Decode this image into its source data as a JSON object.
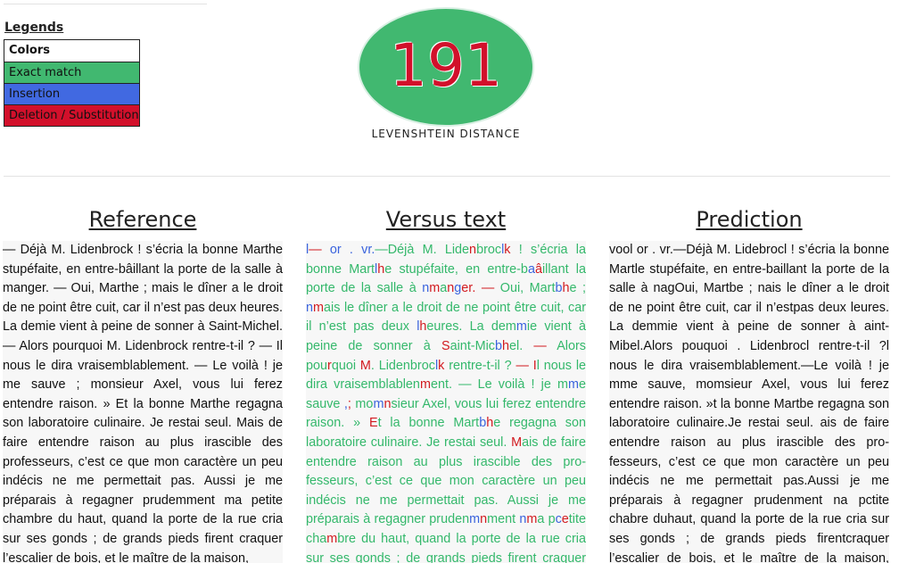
{
  "legend": {
    "title": "Legends",
    "header": "Colors",
    "items": [
      {
        "label": "Exact match",
        "color": "#41b870"
      },
      {
        "label": "Insertion",
        "color": "#4169e1"
      },
      {
        "label": "Deletion / Substitution",
        "color": "#d2102b"
      }
    ]
  },
  "score": {
    "value": "191",
    "label": "LEVENSHTEIN DISTANCE",
    "ellipse_color": "#41b870",
    "number_color": "#d2102b"
  },
  "columns": {
    "reference_title": "Reference",
    "versus_title": "Versus text",
    "prediction_title": "Prediction"
  },
  "reference_text": "— Déjà M. Lidenbrock ! s’écria la bonne Marthe stupéfaite, en entre-bâillant la porte de la salle à manger. — Oui, Marthe ; mais le dîner a le droit de ne point être cuit, car il n’est pas deux heures. La demie vient à peine de sonner à Saint-Michel. — Alors pourquoi M. Lidenbrock rentre-t-il ? — Il nous le dira vraisemblablement. — Le voilà ! je me sauve ; monsieur Axel, vous lui ferez entendre raison. » Et la bonne Marthe regagna son laboratoire culinaire. Je restai seul. Mais de faire entendre raison au plus irascible des professeurs, c’est ce que mon caractère un peu indécis ne me permettait pas. Aussi je me préparais à regagner prudemment ma petite chambre du haut, quand la porte de la rue cria sur ses gonds ; de grands pieds firent craquer l’escalier de bois, et le maître de la maison,",
  "prediction_text": "vool or . vr.—Déjà M. Lidebrocl ! s’écria la bonne Martle stupéfaite, en entre-baillant la porte de la salle à nagOui, Martbe ; nais le dîner a le droit de ne point être cuit, car il n’estpas deux leures. La demmie vient à peine de sonner à aint-Mibel.Alors pouquoi . Lidenbrocl rentre-t-il ?l nous le dira vraisemblablement.—Le voilà ! je mme sauve, momsieur Axel, vous lui ferez entendre raison. »t la bonne Martbe regagna son laboratoire culinaire.Je restai seul. ais de faire entendre raison au plus irascible des pro-fesseurs, c’est ce que mon caractère un peu indécis ne me permettait pas.Aussi je me préparais à regagner prudenment na pctite chabre duhaut, quand la porte de la rue cria sur ses gonds ; de grands pieds firentcraquer l’escalier de bois, et le maître de la maison, traversant la",
  "versus_segments": [
    {
      "t": "l",
      "k": "ins"
    },
    {
      "t": "— ",
      "k": "del"
    },
    {
      "t": "or . vr.",
      "k": "ins"
    },
    {
      "t": "—Déjà M. Lide",
      "k": "match"
    },
    {
      "t": "n",
      "k": "del"
    },
    {
      "t": "broc",
      "k": "match"
    },
    {
      "t": "l",
      "k": "ins"
    },
    {
      "t": "k",
      "k": "del"
    },
    {
      "t": " ! s’écria la bonne Mart",
      "k": "match"
    },
    {
      "t": "l",
      "k": "ins"
    },
    {
      "t": "h",
      "k": "del"
    },
    {
      "t": "e stupéfaite, en entre-b",
      "k": "match"
    },
    {
      "t": "a",
      "k": "ins"
    },
    {
      "t": "â",
      "k": "del"
    },
    {
      "t": "illant la porte de la salle à ",
      "k": "match"
    },
    {
      "t": "n",
      "k": "ins"
    },
    {
      "t": "m",
      "k": "del"
    },
    {
      "t": "a",
      "k": "match"
    },
    {
      "t": "n",
      "k": "del"
    },
    {
      "t": "g",
      "k": "ins"
    },
    {
      "t": "er",
      "k": "del"
    },
    {
      "t": ". — ",
      "k": "del"
    },
    {
      "t": "Oui, Mart",
      "k": "match"
    },
    {
      "t": "b",
      "k": "ins"
    },
    {
      "t": "h",
      "k": "del"
    },
    {
      "t": "e ; ",
      "k": "match"
    },
    {
      "t": "n",
      "k": "ins"
    },
    {
      "t": "m",
      "k": "del"
    },
    {
      "t": "ais le dîner a le droit de ne point être cuit, car il n’est pas deux ",
      "k": "match"
    },
    {
      "t": "l",
      "k": "ins"
    },
    {
      "t": "h",
      "k": "del"
    },
    {
      "t": "eures. La dem",
      "k": "match"
    },
    {
      "t": "m",
      "k": "ins"
    },
    {
      "t": "ie vient à peine de sonner à ",
      "k": "match"
    },
    {
      "t": "S",
      "k": "del"
    },
    {
      "t": "aint-Mic",
      "k": "match"
    },
    {
      "t": "b",
      "k": "ins"
    },
    {
      "t": "h",
      "k": "del"
    },
    {
      "t": "el. ",
      "k": "match"
    },
    {
      "t": "— ",
      "k": "del"
    },
    {
      "t": "Alors pou",
      "k": "match"
    },
    {
      "t": "r",
      "k": "del"
    },
    {
      "t": "quoi ",
      "k": "match"
    },
    {
      "t": "M",
      "k": "del"
    },
    {
      "t": ". Lidenbroc",
      "k": "match"
    },
    {
      "t": "l",
      "k": "ins"
    },
    {
      "t": "k",
      "k": "del"
    },
    {
      "t": " rentre-t-il ? ",
      "k": "match"
    },
    {
      "t": "— I",
      "k": "del"
    },
    {
      "t": "l",
      "k": "match"
    },
    {
      "t": " nous le dira vraisemblablen",
      "k": "match"
    },
    {
      "t": "m",
      "k": "del"
    },
    {
      "t": "ent. — Le voilà ! je m",
      "k": "match"
    },
    {
      "t": "m",
      "k": "ins"
    },
    {
      "t": "e sauve ",
      "k": "match"
    },
    {
      "t": ",",
      "k": "ins"
    },
    {
      "t": ";",
      "k": "del"
    },
    {
      "t": " mo",
      "k": "match"
    },
    {
      "t": "m",
      "k": "ins"
    },
    {
      "t": "n",
      "k": "del"
    },
    {
      "t": "sieur Axel, vous lui ferez entendre raison. » ",
      "k": "match"
    },
    {
      "t": "E",
      "k": "del"
    },
    {
      "t": "t la bonne Mart",
      "k": "match"
    },
    {
      "t": "b",
      "k": "ins"
    },
    {
      "t": "h",
      "k": "del"
    },
    {
      "t": "e regagna son laboratoire culinaire. Je restai seul. ",
      "k": "match"
    },
    {
      "t": "M",
      "k": "del"
    },
    {
      "t": "ais de faire entendre raison au plus irascible des pro-fesseurs, c’est ce que mon caractère un peu indécis ne me permettait pas. Aussi je me préparais à regagner pruden",
      "k": "match"
    },
    {
      "t": "m",
      "k": "ins"
    },
    {
      "t": "n",
      "k": "del"
    },
    {
      "t": "ment ",
      "k": "match"
    },
    {
      "t": "n",
      "k": "ins"
    },
    {
      "t": "m",
      "k": "del"
    },
    {
      "t": "a p",
      "k": "match"
    },
    {
      "t": "c",
      "k": "ins"
    },
    {
      "t": "e",
      "k": "del"
    },
    {
      "t": "tite cha",
      "k": "match"
    },
    {
      "t": "m",
      "k": "del"
    },
    {
      "t": "bre du haut, quand la porte de la rue cria sur ses gonds ; de grands pieds firent craquer l’escalier de bois, et le",
      "k": "match"
    }
  ]
}
